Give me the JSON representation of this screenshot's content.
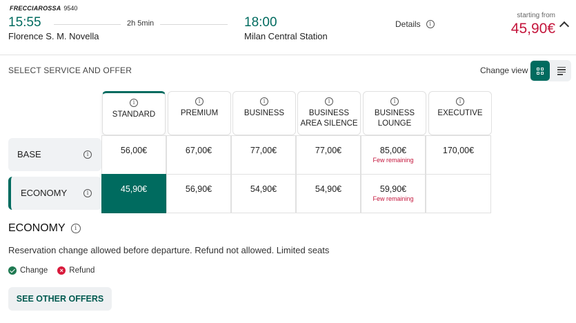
{
  "header": {
    "brand": "FRECCIAROSSA",
    "train_number": "9540",
    "departure_time": "15:55",
    "departure_station": "Florence S. M. Novella",
    "duration": "2h 5min",
    "arrival_time": "18:00",
    "arrival_station": "Milan Central Station",
    "details_label": "Details",
    "starting_from_label": "starting from",
    "starting_price": "45,90€"
  },
  "section": {
    "title": "SELECT SERVICE AND OFFER",
    "change_view_label": "Change view"
  },
  "columns": [
    {
      "label_line1": "STANDARD",
      "label_line2": ""
    },
    {
      "label_line1": "PREMIUM",
      "label_line2": ""
    },
    {
      "label_line1": "BUSINESS",
      "label_line2": ""
    },
    {
      "label_line1": "BUSINESS",
      "label_line2": "AREA SILENCE"
    },
    {
      "label_line1": "BUSINESS",
      "label_line2": "LOUNGE"
    },
    {
      "label_line1": "EXECUTIVE",
      "label_line2": ""
    }
  ],
  "rows": [
    {
      "label": "BASE",
      "cells": [
        {
          "price": "56,00€",
          "note": ""
        },
        {
          "price": "67,00€",
          "note": ""
        },
        {
          "price": "77,00€",
          "note": ""
        },
        {
          "price": "77,00€",
          "note": ""
        },
        {
          "price": "85,00€",
          "note": "Few remaining"
        },
        {
          "price": "170,00€",
          "note": ""
        }
      ]
    },
    {
      "label": "ECONOMY",
      "cells": [
        {
          "price": "45,90€",
          "note": ""
        },
        {
          "price": "56,90€",
          "note": ""
        },
        {
          "price": "54,90€",
          "note": ""
        },
        {
          "price": "54,90€",
          "note": ""
        },
        {
          "price": "59,90€",
          "note": "Few remaining"
        },
        {
          "price": "",
          "note": ""
        }
      ]
    }
  ],
  "offer": {
    "title": "ECONOMY",
    "description": "Reservation change allowed before departure. Refund not allowed. Limited seats",
    "change_label": "Change",
    "refund_label": "Refund",
    "see_other_label": "SEE OTHER OFFERS"
  },
  "colors": {
    "accent": "#006b5f",
    "price_red": "#c4163c",
    "ok_green": "#1f7a52",
    "no_red": "#d8193b"
  },
  "icons": [
    "info-icon",
    "chevron-up-icon",
    "grid-view-icon",
    "list-view-icon",
    "check-circle-icon",
    "cross-circle-icon"
  ]
}
